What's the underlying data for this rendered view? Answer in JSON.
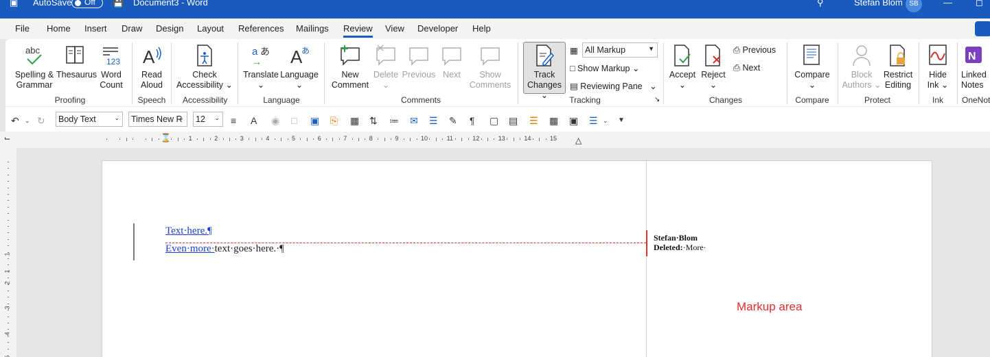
{
  "titlebar": {
    "autosave_label": "AutoSave",
    "autosave_state": "Off",
    "document_title": "Document3  -  Word",
    "user_name": "Stefan Blom",
    "user_initials": "SB"
  },
  "tabs": [
    "File",
    "Home",
    "Insert",
    "Draw",
    "Design",
    "Layout",
    "References",
    "Mailings",
    "Review",
    "View",
    "Developer",
    "Help"
  ],
  "active_tab": "Review",
  "ribbon": {
    "proofing": {
      "label": "Proofing",
      "spelling": "Spelling &",
      "spelling2": "Grammar",
      "thesaurus": "Thesaurus",
      "word_count": "Word",
      "word_count2": "Count"
    },
    "speech": {
      "label": "Speech",
      "read_aloud": "Read",
      "read_aloud2": "Aloud"
    },
    "accessibility": {
      "label": "Accessibility",
      "check": "Check",
      "check2": "Accessibility"
    },
    "language": {
      "label": "Language",
      "translate": "Translate",
      "language": "Language"
    },
    "comments": {
      "label": "Comments",
      "new": "New",
      "new2": "Comment",
      "delete": "Delete",
      "previous": "Previous",
      "next": "Next",
      "show": "Show",
      "show2": "Comments"
    },
    "tracking": {
      "label": "Tracking",
      "track": "Track",
      "track2": "Changes",
      "markup_select": "All Markup",
      "show_markup": "Show Markup",
      "reviewing_pane": "Reviewing Pane"
    },
    "changes": {
      "label": "Changes",
      "accept": "Accept",
      "reject": "Reject",
      "previous": "Previous",
      "next": "Next"
    },
    "compare": {
      "label": "Compare",
      "compare": "Compare"
    },
    "protect": {
      "label": "Protect",
      "block": "Block",
      "block2": "Authors",
      "restrict": "Restrict",
      "restrict2": "Editing"
    },
    "ink": {
      "label": "Ink",
      "hide": "Hide",
      "hide2": "Ink"
    },
    "onenote": {
      "label": "OneNot",
      "linked": "Linked",
      "linked2": "Notes"
    }
  },
  "toolbar": {
    "style": "Body Text",
    "font": "Times New R",
    "size": "12"
  },
  "ruler_numbers": [
    "1",
    "2",
    "3",
    "4",
    "5",
    "6",
    "7",
    "8",
    "9",
    "10",
    "11",
    "12",
    "13",
    "14",
    "15"
  ],
  "vruler_numbers": [
    "1",
    "1",
    "2",
    "3",
    "4",
    "5"
  ],
  "document": {
    "line1_inserted": "Text·here.¶",
    "line2_inserted": "Even·more·",
    "line2_rest": "text·goes·here.·¶",
    "balloon_author": "Stefan·Blom",
    "balloon_type": "Deleted:",
    "balloon_text": "·More·"
  },
  "annotation": "Markup area"
}
